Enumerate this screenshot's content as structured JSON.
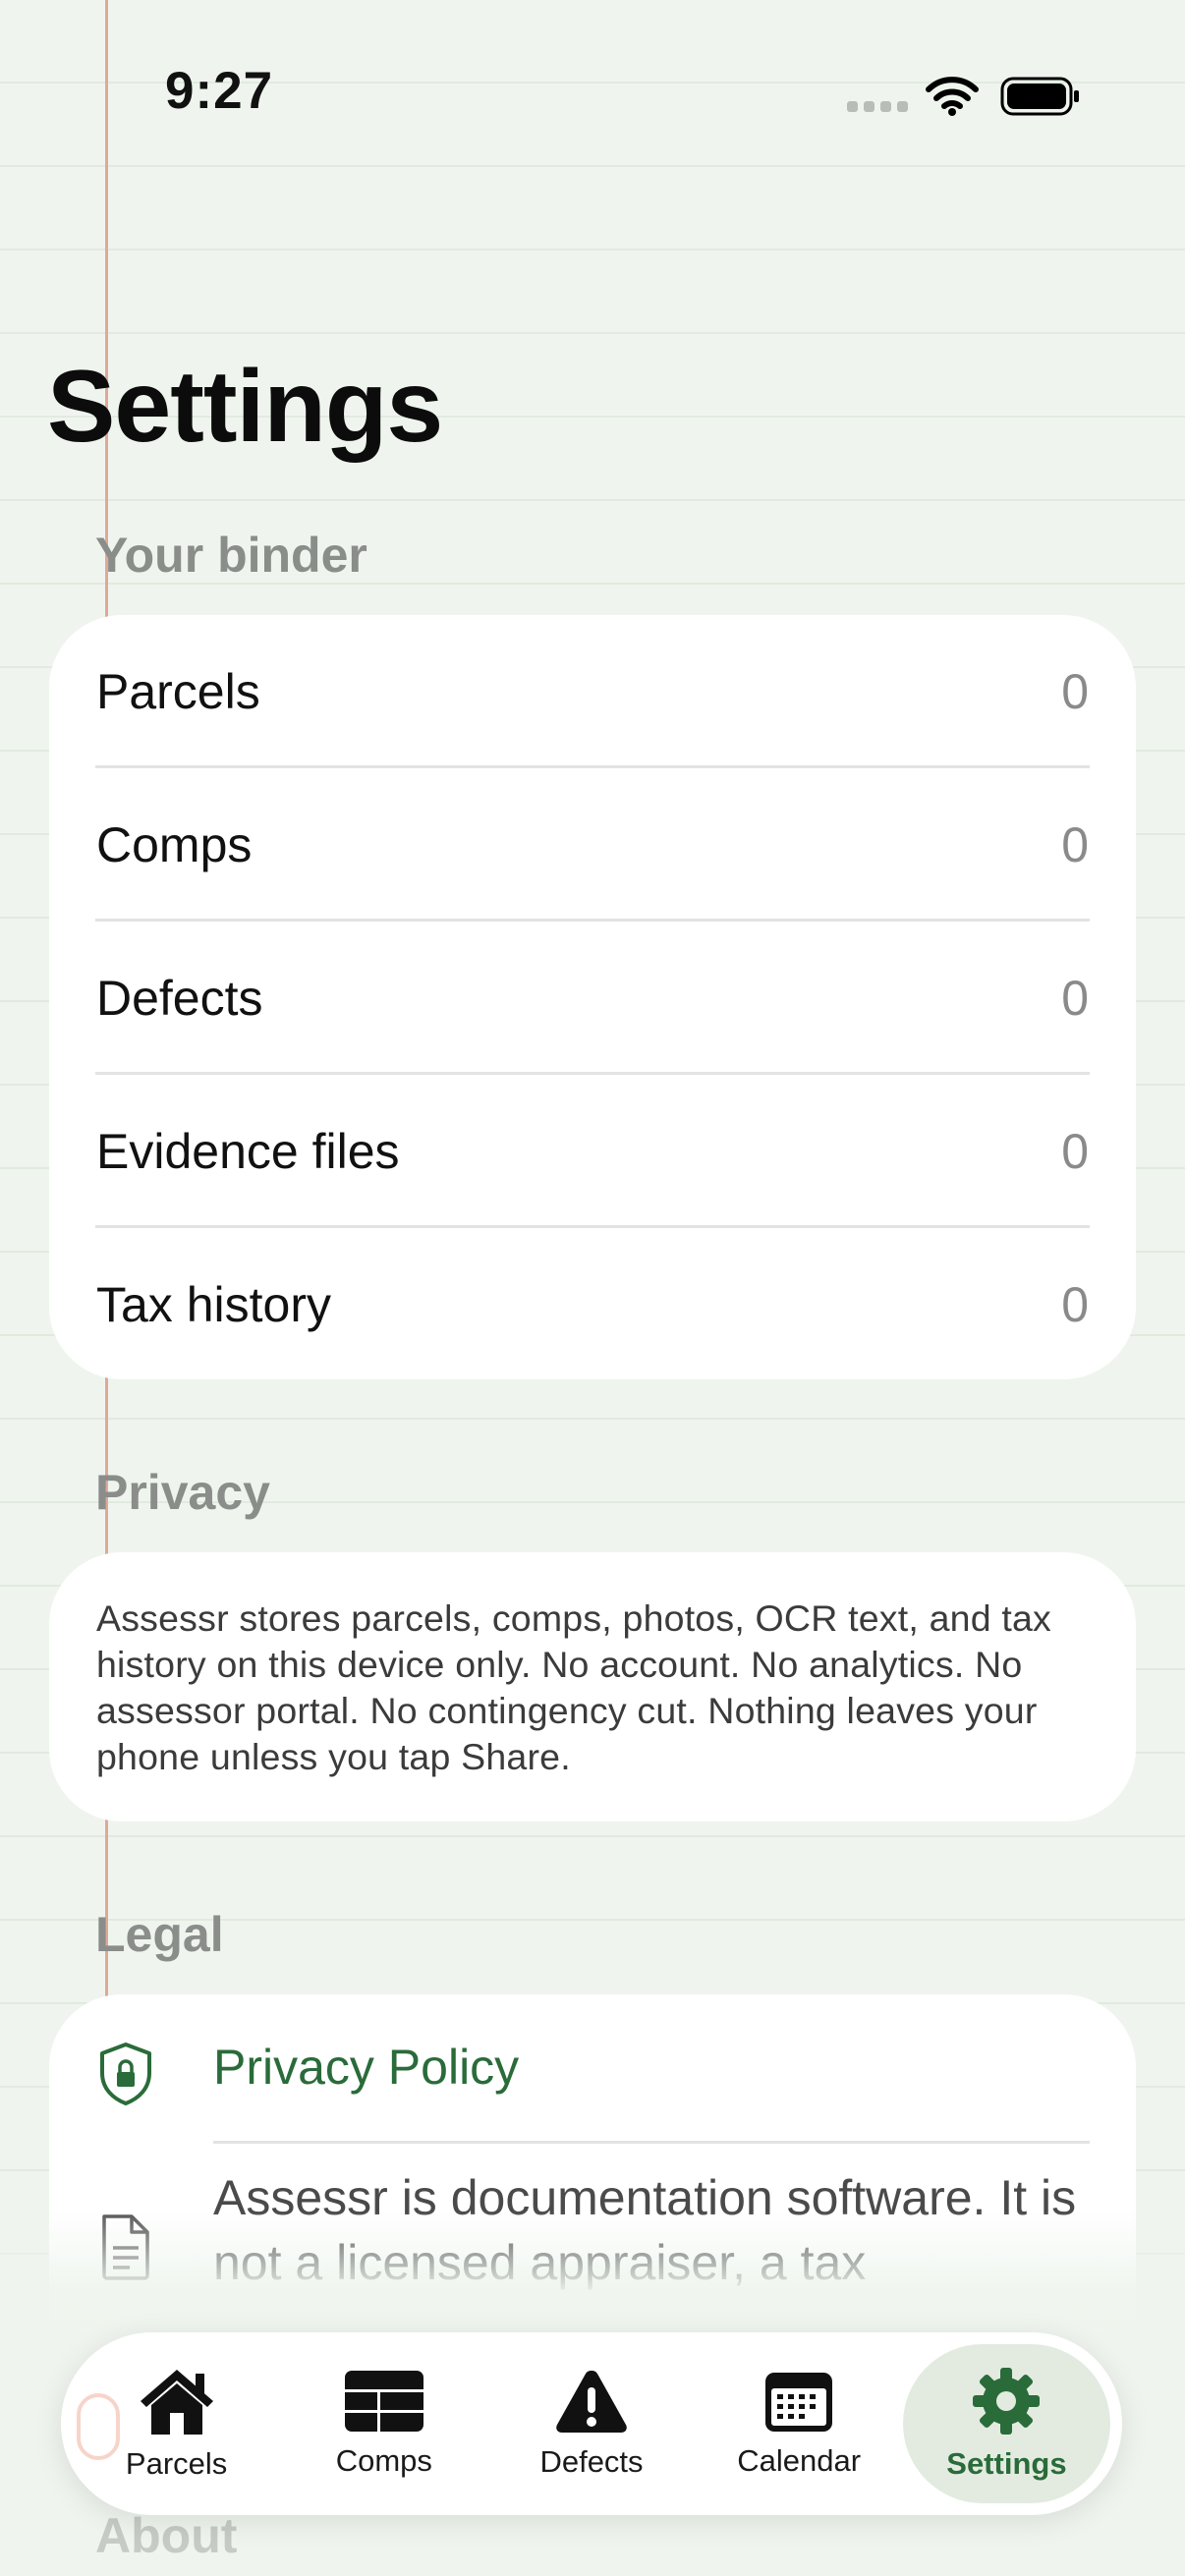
{
  "status_bar": {
    "time": "9:27"
  },
  "page_title": "Settings",
  "binder": {
    "header": "Your binder",
    "rows": [
      {
        "label": "Parcels",
        "value": "0"
      },
      {
        "label": "Comps",
        "value": "0"
      },
      {
        "label": "Defects",
        "value": "0"
      },
      {
        "label": "Evidence files",
        "value": "0"
      },
      {
        "label": "Tax history",
        "value": "0"
      }
    ]
  },
  "privacy": {
    "header": "Privacy",
    "text": "Assessr stores parcels, comps, photos, OCR text, and tax history on this device only. No account. No analytics. No assessor portal. No contingency cut. Nothing leaves your phone unless you tap Share."
  },
  "legal": {
    "header": "Legal",
    "privacy_policy": "Privacy Policy",
    "disclaimer": "Assessr is documentation software. It is not a licensed appraiser, a tax"
  },
  "about_header": "About",
  "tabs": [
    {
      "label": "Parcels",
      "icon": "house-icon",
      "active": false
    },
    {
      "label": "Comps",
      "icon": "table-icon",
      "active": false
    },
    {
      "label": "Defects",
      "icon": "warning-icon",
      "active": false
    },
    {
      "label": "Calendar",
      "icon": "calendar-icon",
      "active": false
    },
    {
      "label": "Settings",
      "icon": "gear-icon",
      "active": true
    }
  ],
  "colors": {
    "accent": "#2a6b3a",
    "background": "#eff5ee",
    "margin_line": "#e0a898"
  }
}
